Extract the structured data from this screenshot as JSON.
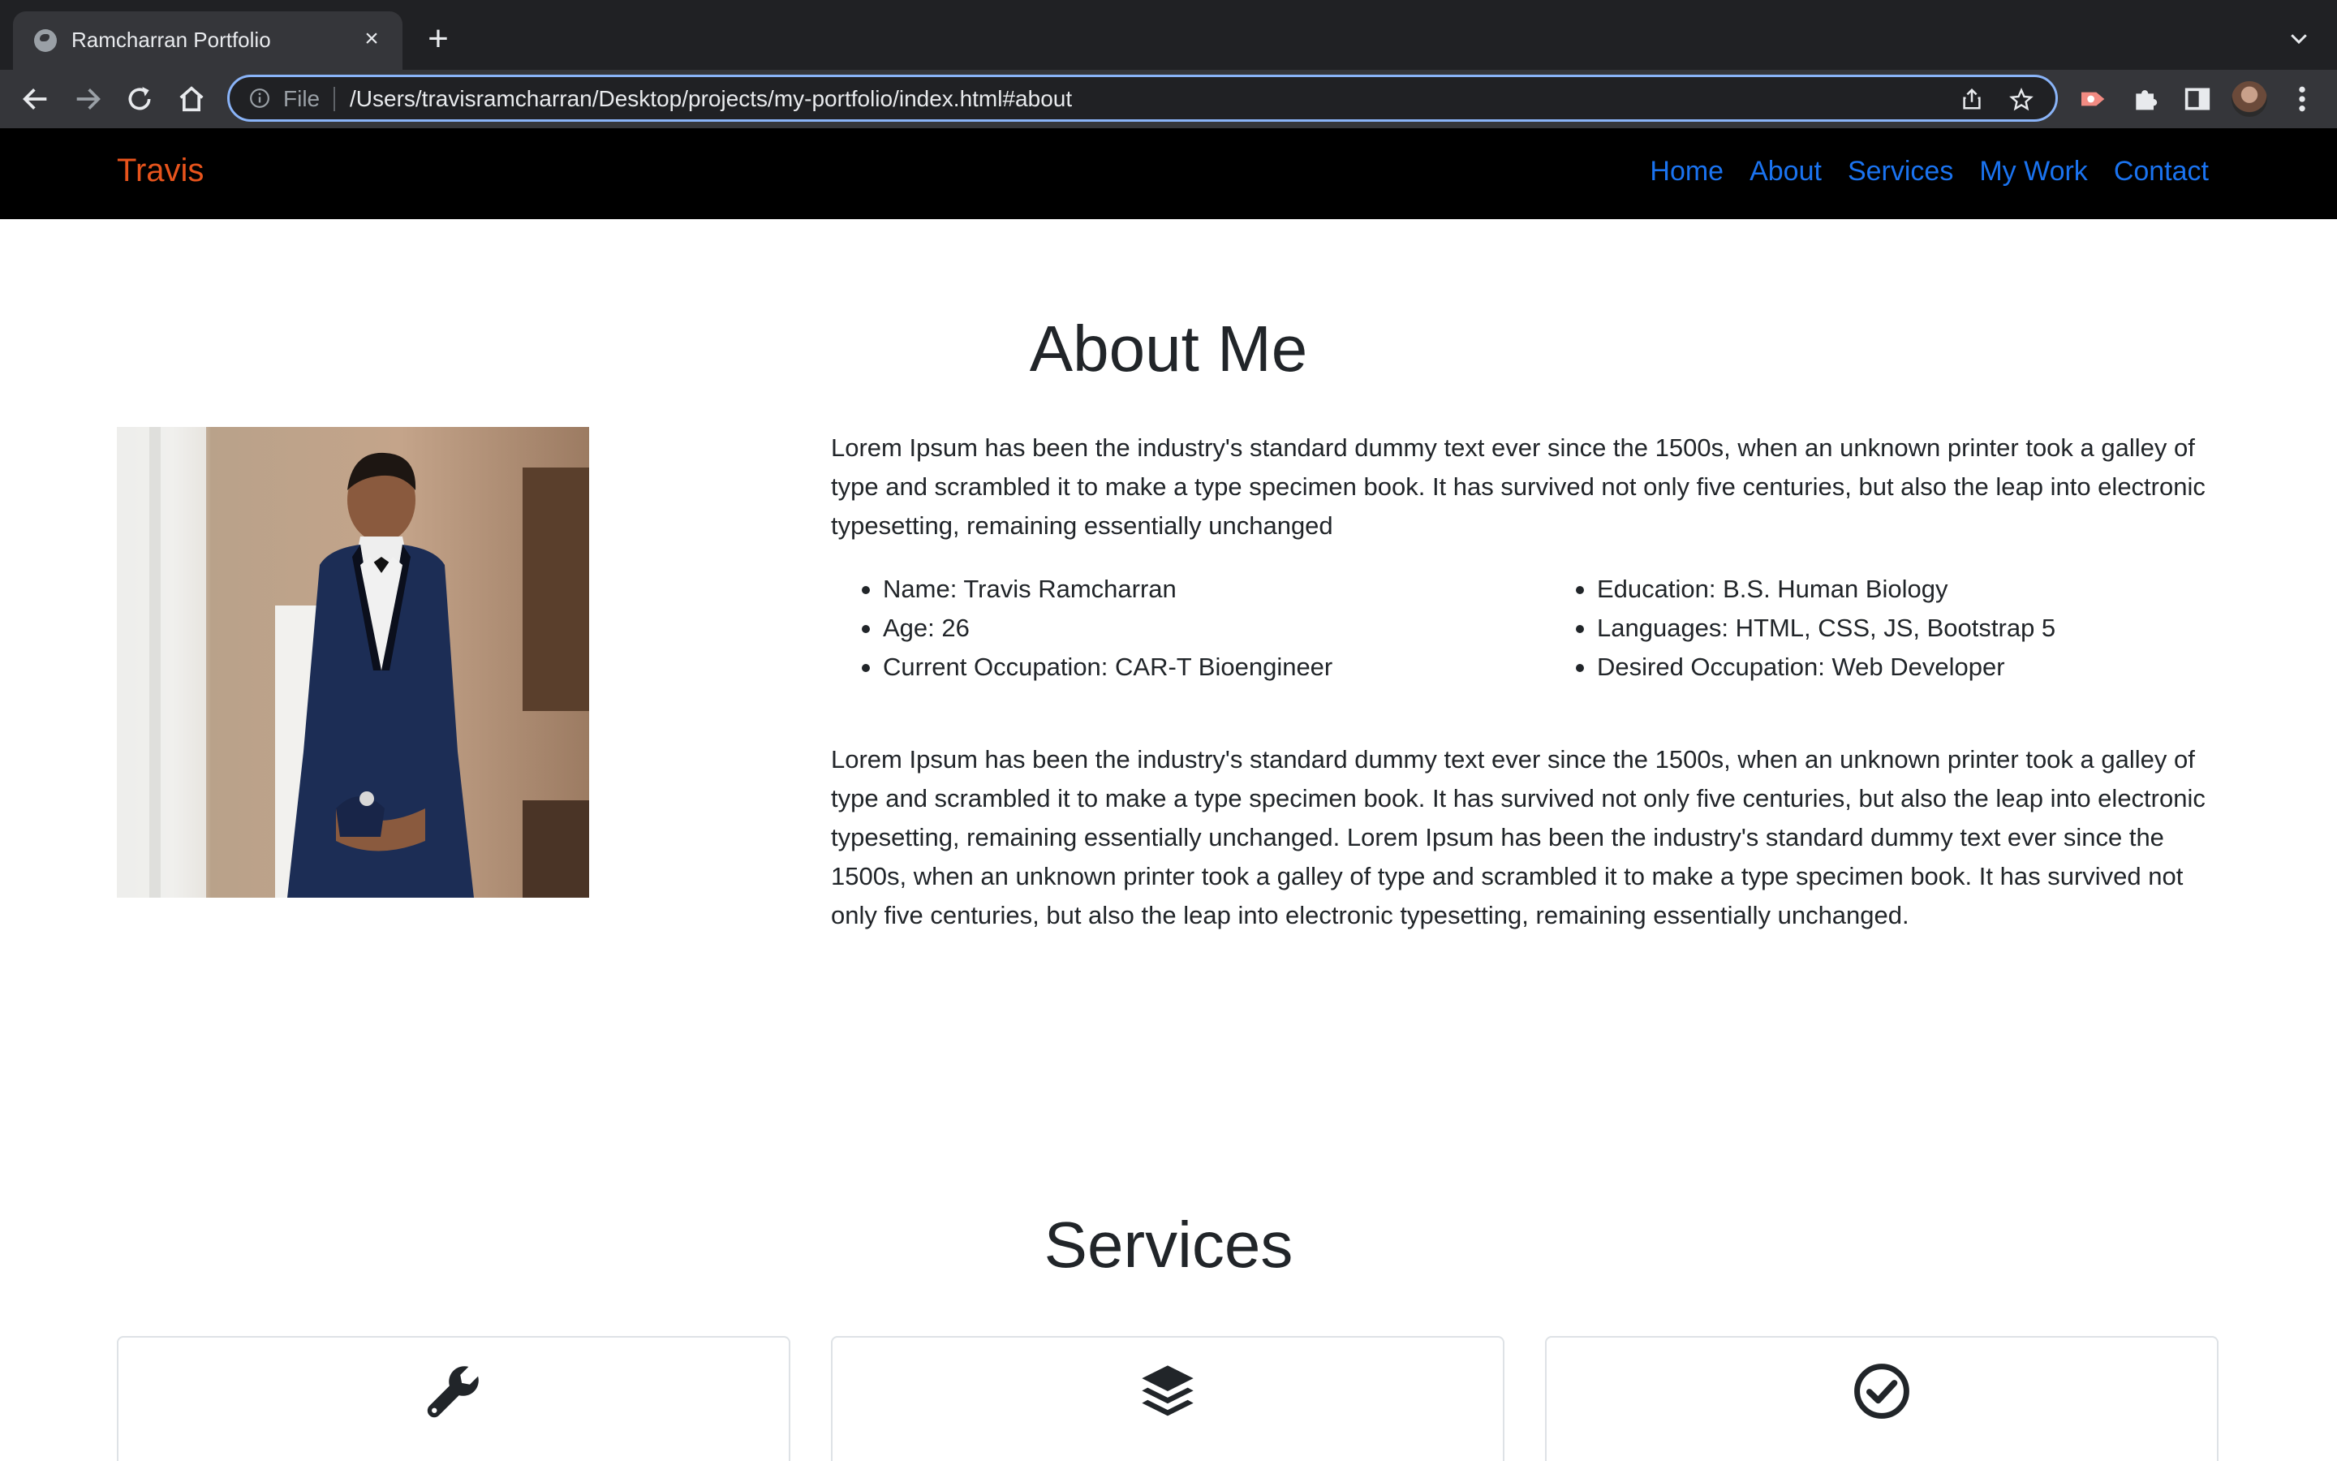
{
  "browser": {
    "tab_title": "Ramcharran Portfolio",
    "url_scheme": "File",
    "url": "/Users/travisramcharran/Desktop/projects/my-portfolio/index.html#about"
  },
  "site": {
    "brand": "Travis",
    "nav": [
      {
        "label": "Home"
      },
      {
        "label": "About"
      },
      {
        "label": "Services"
      },
      {
        "label": "My Work"
      },
      {
        "label": "Contact"
      }
    ]
  },
  "about": {
    "title": "About Me",
    "paragraph1": "Lorem Ipsum has been the industry's standard dummy text ever since the 1500s, when an unknown printer took a galley of type and scrambled it to make a type specimen book. It has survived not only five centuries, but also the leap into electronic typesetting, remaining essentially unchanged",
    "details_left": [
      "Name: Travis Ramcharran",
      "Age: 26",
      "Current Occupation: CAR-T Bioengineer"
    ],
    "details_right": [
      "Education: B.S. Human Biology",
      "Languages: HTML, CSS, JS, Bootstrap 5",
      "Desired Occupation: Web Developer"
    ],
    "paragraph2": "Lorem Ipsum has been the industry's standard dummy text ever since the 1500s, when an unknown printer took a galley of type and scrambled it to make a type specimen book. It has survived not only five centuries, but also the leap into electronic typesetting, remaining essentially unchanged. Lorem Ipsum has been the industry's standard dummy text ever since the 1500s, when an unknown printer took a galley of type and scrambled it to make a type specimen book. It has survived not only five centuries, but also the leap into electronic typesetting, remaining essentially unchanged."
  },
  "services": {
    "title": "Services",
    "cards": [
      {
        "icon": "wrench-icon",
        "title": ""
      },
      {
        "icon": "layers-icon",
        "title": ""
      },
      {
        "icon": "check-circle-icon",
        "title": ""
      }
    ]
  },
  "colors": {
    "brand": "#e8541c",
    "nav_link": "#1a73f0",
    "navbar_bg": "#000000"
  }
}
